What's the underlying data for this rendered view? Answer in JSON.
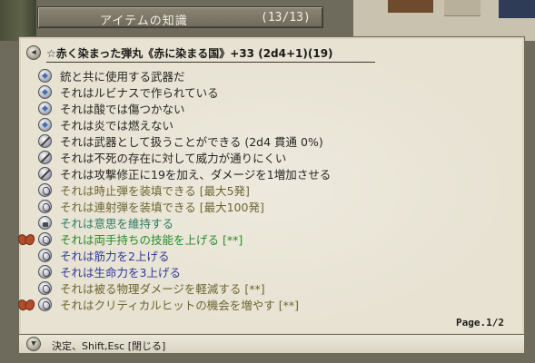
{
  "window": {
    "title": "アイテムの知識",
    "count": "(13/13)"
  },
  "item": {
    "name": "☆赤く染まった弾丸《赤に染まる国》+33 (2d4+1)(19)"
  },
  "lines": [
    {
      "icon": "diamond-icon",
      "marker": "",
      "color": "black",
      "text": "銃と共に使用する武器だ"
    },
    {
      "icon": "diamond-icon",
      "marker": "",
      "color": "black",
      "text": "それはルビナスで作られている"
    },
    {
      "icon": "diamond-icon",
      "marker": "",
      "color": "black",
      "text": "それは酸では傷つかない"
    },
    {
      "icon": "diamond-icon",
      "marker": "",
      "color": "black",
      "text": "それは炎では燃えない"
    },
    {
      "icon": "sword-icon",
      "marker": "",
      "color": "black",
      "text": "それは武器として扱うことができる (2d4 貫通 0%)"
    },
    {
      "icon": "sword-icon",
      "marker": "",
      "color": "black",
      "text": "それは不死の存在に対して威力が通りにくい"
    },
    {
      "icon": "sword-icon",
      "marker": "",
      "color": "black",
      "text": "それは攻撃修正に19を加え、ダメージを1増加させる"
    },
    {
      "icon": "round-icon",
      "marker": "",
      "color": "olive",
      "text": "それは時止弾を装填できる [最大5発]"
    },
    {
      "icon": "round-icon",
      "marker": "",
      "color": "olive",
      "text": "それは連射弾を装填できる [最大100発]"
    },
    {
      "icon": "lock-icon",
      "marker": "",
      "color": "teal",
      "text": "それは意思を維持する"
    },
    {
      "icon": "round-icon",
      "marker": "bow-icon",
      "color": "green",
      "text": "それは両手持ちの技能を上げる [**]"
    },
    {
      "icon": "round-icon",
      "marker": "",
      "color": "blue",
      "text": "それは筋力を2上げる"
    },
    {
      "icon": "round-icon",
      "marker": "",
      "color": "blue",
      "text": "それは生命力を3上げる"
    },
    {
      "icon": "round-icon",
      "marker": "",
      "color": "olive",
      "text": "それは被る物理ダメージを軽減する [**]"
    },
    {
      "icon": "round-icon",
      "marker": "bow-icon",
      "color": "olive",
      "text": "それはクリティカルヒットの機会を増やす [**]"
    }
  ],
  "page": "Page.1/2",
  "footer": {
    "help": "決定、Shift,Esc [閉じる]"
  },
  "colors": {
    "black": "#262624",
    "olive": "#6e6530",
    "teal": "#2b7b63",
    "green": "#2a8a2a",
    "blue": "#2d3a9a"
  }
}
